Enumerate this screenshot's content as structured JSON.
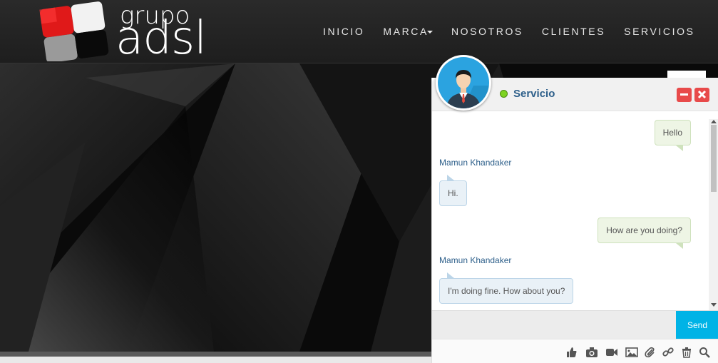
{
  "logo": {
    "small": "grupo",
    "big": "adsl"
  },
  "nav": {
    "items": [
      {
        "label": "INICIO"
      },
      {
        "label": "MARCA",
        "has_dropdown": true
      },
      {
        "label": "NOSOTROS"
      },
      {
        "label": "CLIENTES"
      },
      {
        "label": "SERVICIOS"
      }
    ]
  },
  "chat": {
    "title": "Servicio",
    "status_color": "#7ed321",
    "minimize_icon": "minus-icon",
    "close_icon": "close-icon",
    "messages": [
      {
        "direction": "out",
        "text": "Hello"
      },
      {
        "direction": "in",
        "sender": "Mamun Khandaker",
        "text": "Hi."
      },
      {
        "direction": "out",
        "text": "How are you doing?"
      },
      {
        "direction": "in",
        "sender": "Mamun Khandaker",
        "text": "I'm doing fine. How about you?"
      }
    ],
    "input": {
      "value": "",
      "placeholder": ""
    },
    "send_label": "Send",
    "toolbar_icons": [
      "thumbs-up-icon",
      "camera-icon",
      "video-icon",
      "image-icon",
      "paperclip-icon",
      "link-icon",
      "trash-icon",
      "search-icon"
    ]
  },
  "colors": {
    "accent": "#00b3e6",
    "title": "#2d5f8a",
    "close": "#e84a4a",
    "brand_red": "#e01919"
  }
}
